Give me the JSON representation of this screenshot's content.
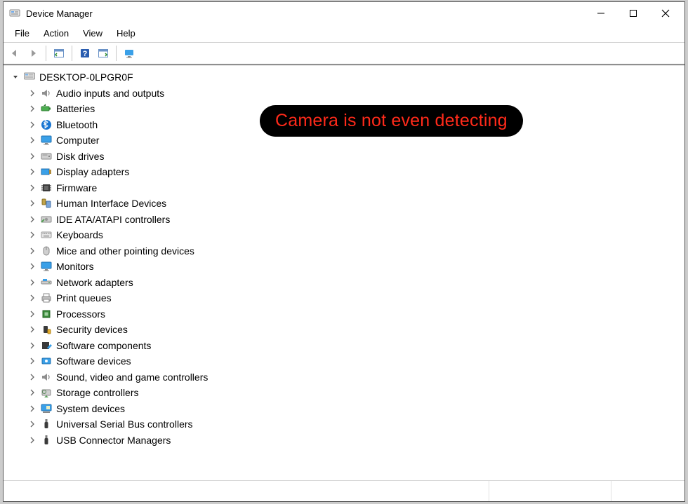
{
  "window": {
    "title": "Device Manager"
  },
  "menubar": {
    "items": [
      "File",
      "Action",
      "View",
      "Help"
    ]
  },
  "tree": {
    "root": {
      "label": "DESKTOP-0LPGR0F",
      "expanded": true
    },
    "categories": [
      {
        "label": "Audio inputs and outputs",
        "icon": "speaker"
      },
      {
        "label": "Batteries",
        "icon": "battery"
      },
      {
        "label": "Bluetooth",
        "icon": "bluetooth"
      },
      {
        "label": "Computer",
        "icon": "monitor"
      },
      {
        "label": "Disk drives",
        "icon": "disk"
      },
      {
        "label": "Display adapters",
        "icon": "display-adapter"
      },
      {
        "label": "Firmware",
        "icon": "chip"
      },
      {
        "label": "Human Interface Devices",
        "icon": "hid"
      },
      {
        "label": "IDE ATA/ATAPI controllers",
        "icon": "ide"
      },
      {
        "label": "Keyboards",
        "icon": "keyboard"
      },
      {
        "label": "Mice and other pointing devices",
        "icon": "mouse"
      },
      {
        "label": "Monitors",
        "icon": "monitor"
      },
      {
        "label": "Network adapters",
        "icon": "network"
      },
      {
        "label": "Print queues",
        "icon": "printer"
      },
      {
        "label": "Processors",
        "icon": "cpu"
      },
      {
        "label": "Security devices",
        "icon": "security"
      },
      {
        "label": "Software components",
        "icon": "soft-comp"
      },
      {
        "label": "Software devices",
        "icon": "soft-dev"
      },
      {
        "label": "Sound, video and game controllers",
        "icon": "speaker"
      },
      {
        "label": "Storage controllers",
        "icon": "storage"
      },
      {
        "label": "System devices",
        "icon": "system"
      },
      {
        "label": "Universal Serial Bus controllers",
        "icon": "usb"
      },
      {
        "label": "USB Connector Managers",
        "icon": "usb"
      }
    ]
  },
  "annotation": {
    "text": "Camera is not even detecting"
  }
}
